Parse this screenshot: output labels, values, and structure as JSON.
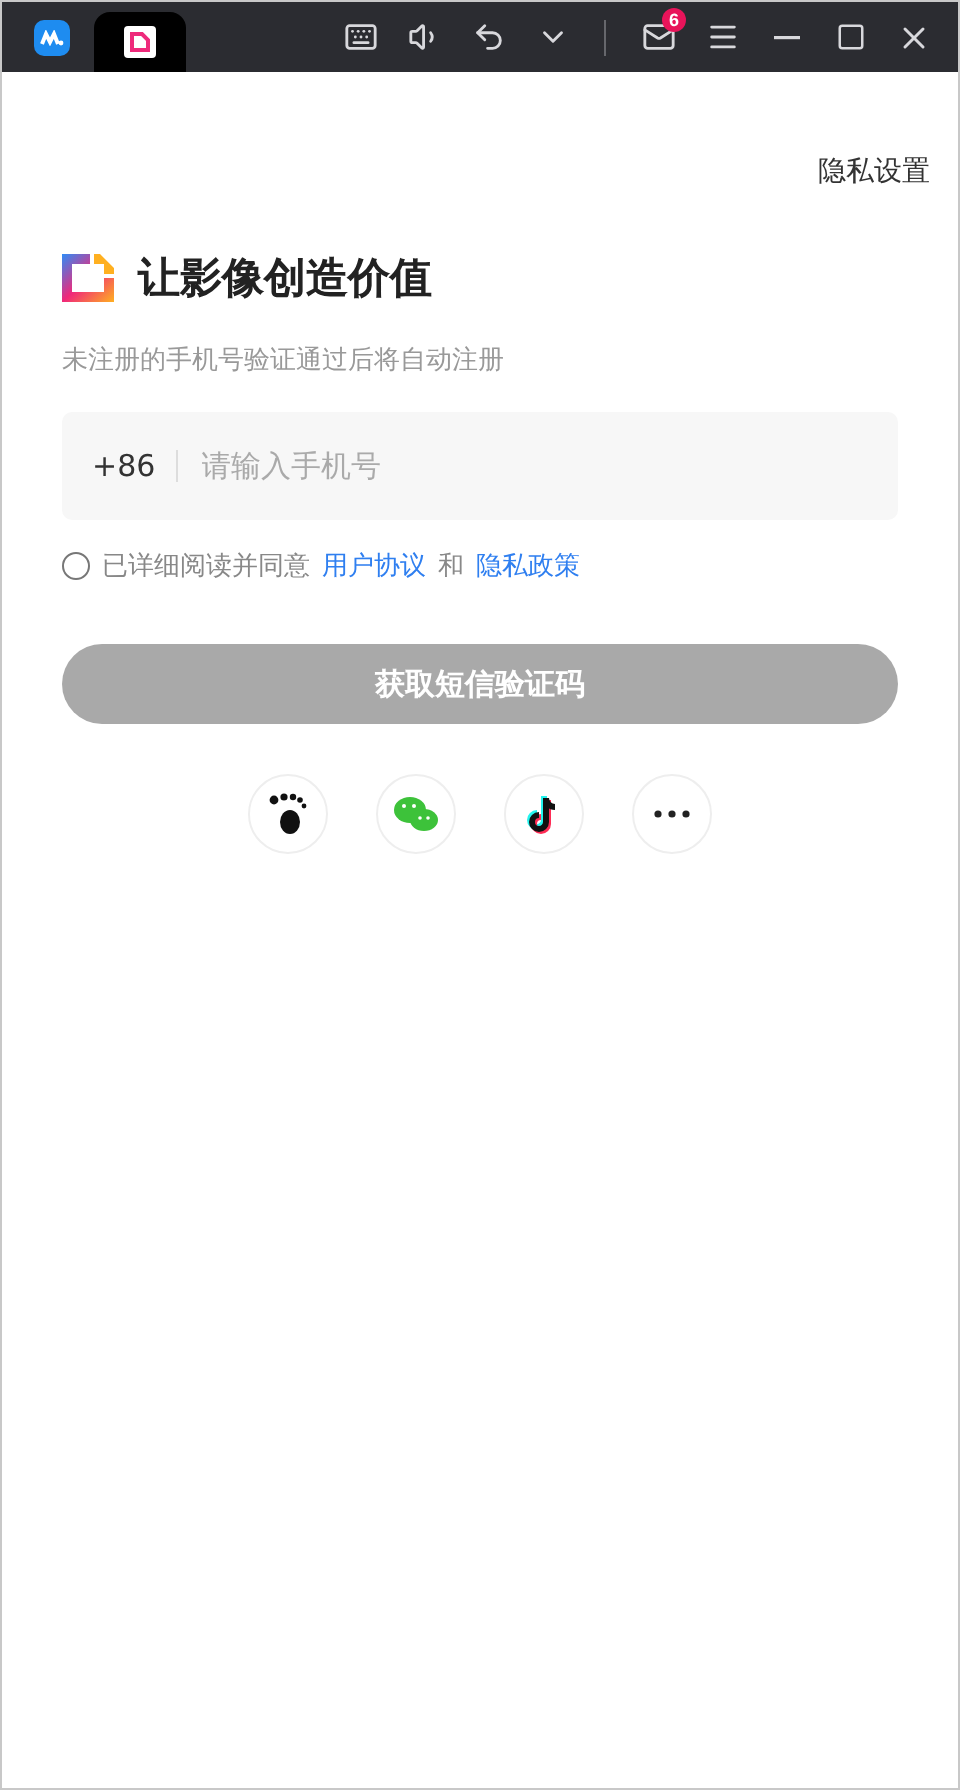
{
  "titlebar": {
    "mail_badge": "6"
  },
  "privacy_settings": "隐私设置",
  "headline": "让影像创造价值",
  "subtitle": "未注册的手机号验证通过后将自动注册",
  "phone_field": {
    "prefix": "+86",
    "placeholder": "请输入手机号"
  },
  "agreement": {
    "checked": false,
    "text": "已详细阅读并同意",
    "terms_link": "用户协议",
    "joiner": "和",
    "privacy_link": "隐私政策"
  },
  "submit_button": {
    "label": "获取短信验证码",
    "disabled": true
  },
  "social_logins": [
    {
      "kind": "footprint"
    },
    {
      "kind": "wechat"
    },
    {
      "kind": "tiktok"
    },
    {
      "kind": "more"
    }
  ]
}
